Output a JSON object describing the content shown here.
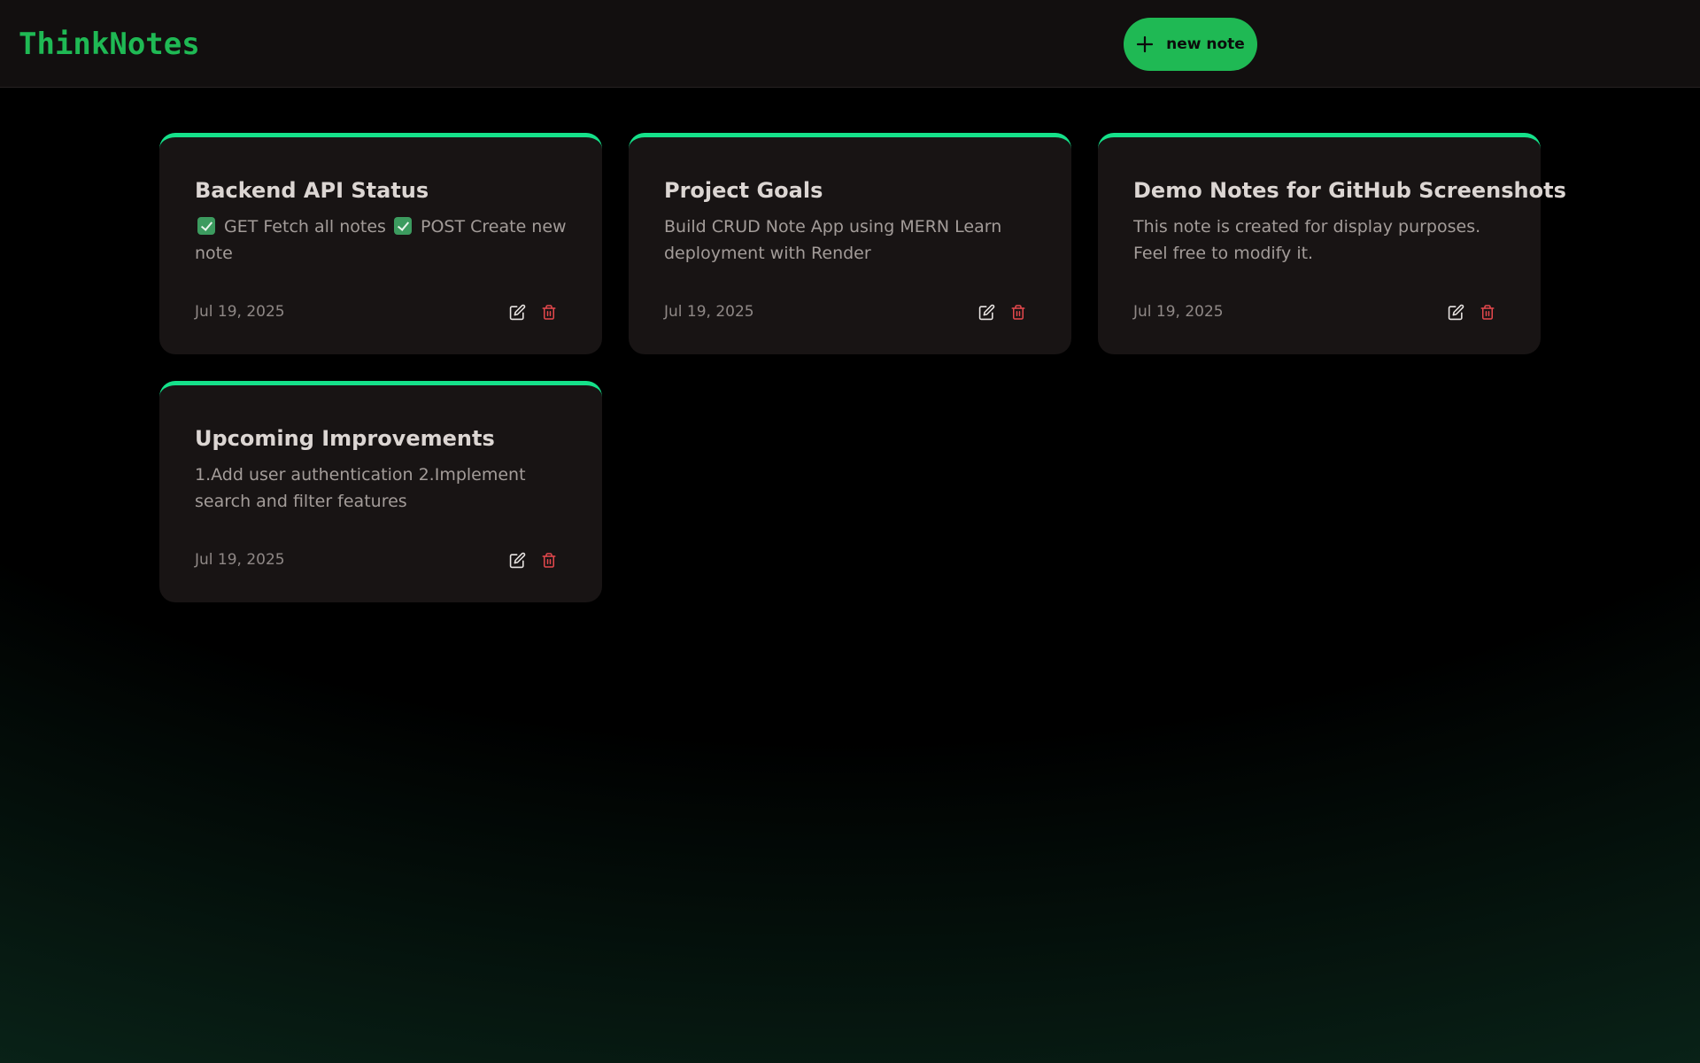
{
  "app": {
    "logo": "ThinkNotes",
    "new_note_label": "new note"
  },
  "colors": {
    "accent": "#1fb954",
    "card_top_border": "#15e18a",
    "delete_icon": "#e5484d"
  },
  "notes": [
    {
      "title": "Backend API Status",
      "content_parts": [
        "GET Fetch all notes",
        "POST Create new note"
      ],
      "date": "Jul 19, 2025"
    },
    {
      "title": "Project Goals",
      "content": "Build CRUD Note App using MERN Learn deployment with Render",
      "date": "Jul 19, 2025"
    },
    {
      "title": "Demo Notes for GitHub Screenshots",
      "content": "This note is created for display purposes. Feel free to modify it.",
      "date": "Jul 19, 2025"
    },
    {
      "title": "Upcoming Improvements",
      "content": "1.Add user authentication 2.Implement search and filter features",
      "date": "Jul 19, 2025"
    }
  ],
  "icons": {
    "edit": "edit-icon",
    "delete": "trash-icon",
    "add": "plus-icon",
    "checkbox": "check-box-icon"
  }
}
